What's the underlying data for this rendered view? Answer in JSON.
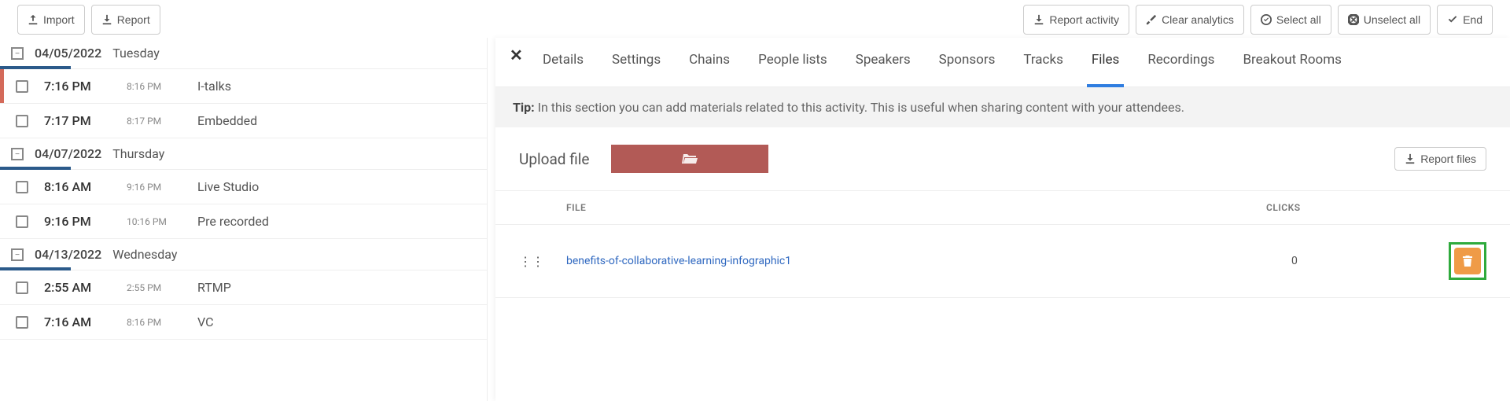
{
  "toolbar_left": {
    "import": "Import",
    "report": "Report"
  },
  "toolbar_right": {
    "report_activity": "Report activity",
    "clear_analytics": "Clear analytics",
    "select_all": "Select all",
    "unselect_all": "Unselect all",
    "end": "End"
  },
  "schedule": [
    {
      "date": "04/05/2022",
      "dow": "Tuesday",
      "rows": [
        {
          "t1": "7:16 PM",
          "t2": "8:16 PM",
          "title": "I-talks",
          "selected": true
        },
        {
          "t1": "7:17 PM",
          "t2": "8:17 PM",
          "title": "Embedded",
          "selected": false
        }
      ]
    },
    {
      "date": "04/07/2022",
      "dow": "Thursday",
      "rows": [
        {
          "t1": "8:16 AM",
          "t2": "9:16 PM",
          "title": "Live Studio",
          "selected": false
        },
        {
          "t1": "9:16 PM",
          "t2": "10:16 PM",
          "title": "Pre recorded",
          "selected": false
        }
      ]
    },
    {
      "date": "04/13/2022",
      "dow": "Wednesday",
      "rows": [
        {
          "t1": "2:55 AM",
          "t2": "2:55 PM",
          "title": "RTMP",
          "selected": false
        },
        {
          "t1": "7:16 AM",
          "t2": "8:16 PM",
          "title": "VC",
          "selected": false
        }
      ]
    }
  ],
  "tabs": [
    "Details",
    "Settings",
    "Chains",
    "People lists",
    "Speakers",
    "Sponsors",
    "Tracks",
    "Files",
    "Recordings",
    "Breakout Rooms"
  ],
  "active_tab": "Files",
  "tip_label": "Tip:",
  "tip_text": "In this section you can add materials related to this activity. This is useful when sharing content with your attendees.",
  "upload_label": "Upload file",
  "report_files": "Report files",
  "table": {
    "head_file": "FILE",
    "head_clicks": "CLICKS",
    "rows": [
      {
        "name": "benefits-of-collaborative-learning-infographic1",
        "clicks": "0"
      }
    ]
  }
}
